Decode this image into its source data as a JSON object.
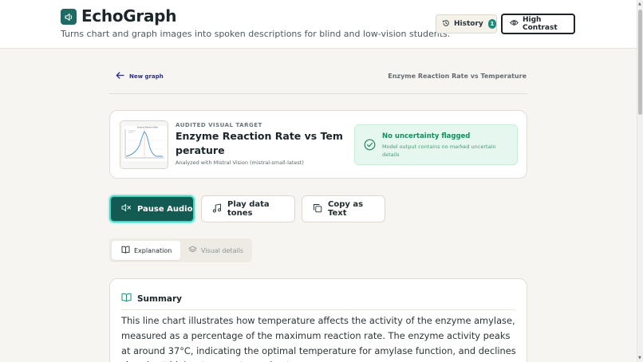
{
  "app": {
    "title": "EchoGraph",
    "tagline": "Turns chart and graph images into spoken descriptions for blind and low-vision students."
  },
  "header": {
    "history_label": "History",
    "history_count": "1",
    "contrast_label": "High Contrast"
  },
  "nav": {
    "back_label": "New graph",
    "current_title": "Enzyme Reaction Rate vs Temperature"
  },
  "target": {
    "eyebrow": "AUDITED VISUAL TARGET",
    "title": "Enzyme Reaction Rate vs Temperature",
    "analyzed_with": "Analyzed with Mistral Vision (mistral-small-latest)",
    "flag_title": "No uncertainty flagged",
    "flag_text": "Model output contains no marked uncertain details"
  },
  "actions": {
    "pause_label": "Pause Audio",
    "tones_label": "Play data tones",
    "copy_label": "Copy as Text"
  },
  "tabs": {
    "explanation": "Explanation",
    "visual_details": "Visual details"
  },
  "summary": {
    "heading": "Summary",
    "body": "This line chart illustrates how temperature affects the activity of the enzyme amylase, measured as a percentage of the maximum reaction rate. The enzyme activity peaks at around 37°C, indicating the optimal temperature for amylase function, and declines sharply at higher temperatures due to"
  },
  "colors": {
    "brand": "#1f6b63",
    "primary_button": "#135a53",
    "success_bg": "#e5f7ee",
    "success_text": "#1a8a60",
    "link": "#2b2f86"
  }
}
